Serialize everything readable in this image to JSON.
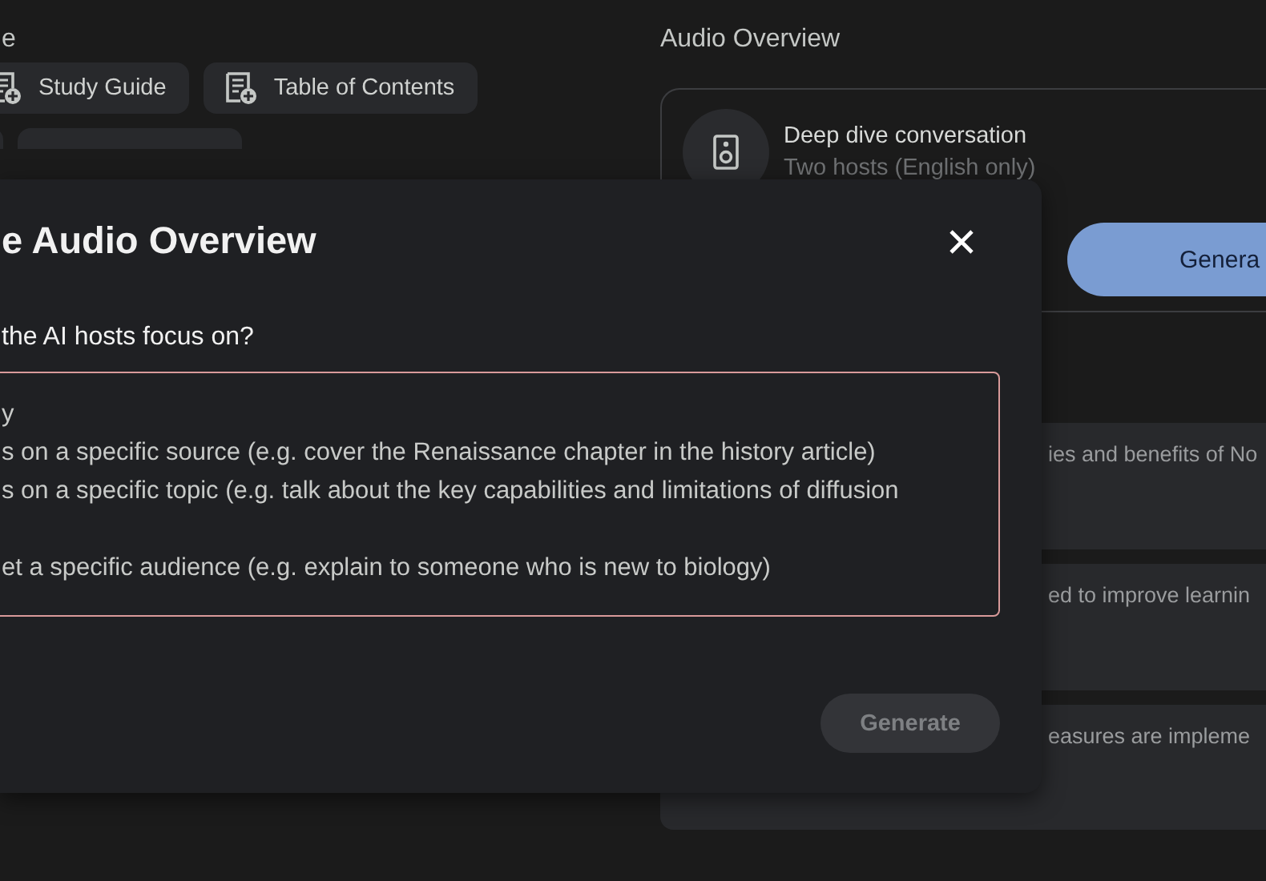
{
  "notes_panel": {
    "heading": "e",
    "chips": [
      {
        "label": "Study Guide"
      },
      {
        "label": "Table of Contents"
      }
    ]
  },
  "audio_overview": {
    "heading": "Audio Overview",
    "card": {
      "title": "Deep dive conversation",
      "subtitle": "Two hosts (English only)",
      "generate_button": "Genera"
    },
    "suggestions": [
      "ies and benefits of No",
      "ed to improve learnin",
      "easures are impleme"
    ]
  },
  "dialog": {
    "title": "e Audio Overview",
    "question": "the AI hosts focus on?",
    "focus_field": {
      "placeholder": "y\ns on a specific source (e.g. cover the Renaissance chapter in the history article)\ns on a specific topic (e.g. talk about the key capabilities and limitations of diffusion\n\net a specific audience (e.g. explain to someone who is new to biology)",
      "focused": true
    },
    "generate_button": {
      "label": "Generate",
      "disabled": true
    }
  }
}
